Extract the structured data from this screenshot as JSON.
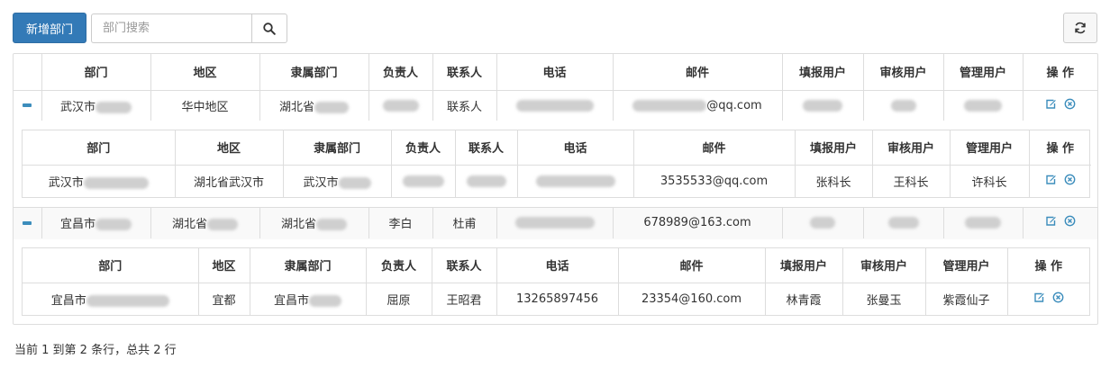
{
  "toolbar": {
    "add_label": "新增部门",
    "search_placeholder": "部门搜索"
  },
  "columns": {
    "dept": "部门",
    "region": "地区",
    "parent": "隶属部门",
    "owner": "负责人",
    "contact": "联系人",
    "phone": "电话",
    "email": "邮件",
    "filler": "填报用户",
    "reviewer": "审核用户",
    "admin": "管理用户",
    "ops": "操 作"
  },
  "rows": [
    {
      "dept": "武汉市",
      "region": "华中地区",
      "parent": "湖北省",
      "contact": "联系人",
      "email": "@qq.com",
      "children": [
        {
          "dept": "武汉市",
          "region": "湖北省武汉市",
          "parent": "武汉市",
          "email": "3535533@qq.com",
          "filler": "张科长",
          "reviewer": "王科长",
          "admin": "许科长"
        }
      ]
    },
    {
      "dept": "宜昌市",
      "region": "湖北省",
      "parent": "湖北省",
      "owner": "李白",
      "contact": "杜甫",
      "email": "678989@163.com",
      "children": [
        {
          "dept": "宜昌市",
          "region": "宜都",
          "parent": "宜昌市",
          "owner": "屈原",
          "contact": "王昭君",
          "phone": "13265897456",
          "email": "23354@160.com",
          "filler": "林青霞",
          "reviewer": "张曼玉",
          "admin": "紫霞仙子"
        }
      ]
    }
  ],
  "footer": {
    "pagination_text": "当前 1 到第 2 条行，总共 2 行"
  },
  "colors": {
    "primary": "#337ab7",
    "icon": "#3c8dbc",
    "border": "#dddddd"
  },
  "icons": [
    "search-icon",
    "refresh-icon",
    "collapse-icon",
    "edit-icon",
    "delete-icon"
  ]
}
